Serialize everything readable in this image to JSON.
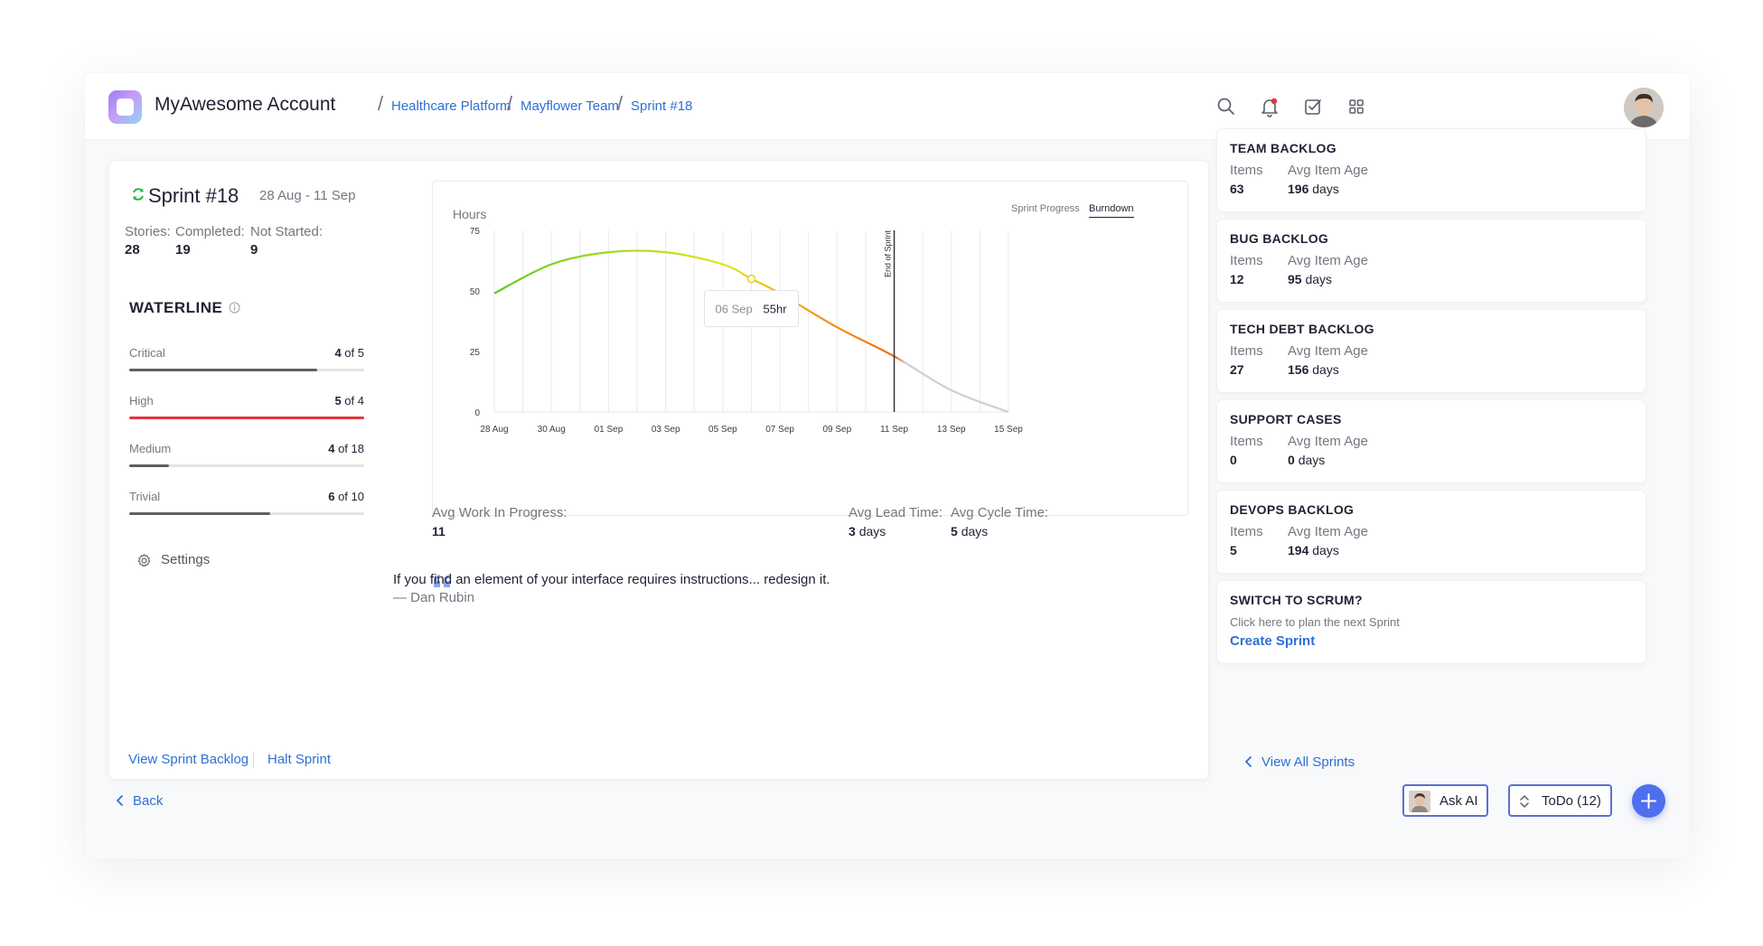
{
  "header": {
    "account": "MyAwesome Account",
    "separator": "/",
    "breadcrumbs": [
      "Healthcare Platform",
      "Mayflower Team",
      "Sprint #18"
    ],
    "icons": [
      "search-icon",
      "bell-icon",
      "checkbox-icon",
      "grid-icon"
    ]
  },
  "sprint": {
    "title": "Sprint #18",
    "dates": "28 Aug - 11 Sep",
    "stats": [
      {
        "label": "Stories:",
        "value": "28"
      },
      {
        "label": "Completed:",
        "value": "19"
      },
      {
        "label": "Not Started:",
        "value": "9"
      }
    ]
  },
  "waterline": {
    "title": "WATERLINE",
    "rows": [
      {
        "label": "Critical",
        "count": "4",
        "of": "of",
        "total": "5",
        "fill": 0.8,
        "color": "#5d5f66"
      },
      {
        "label": "High",
        "count": "5",
        "of": "of",
        "total": "4",
        "fill": 1.0,
        "color": "#e5343d"
      },
      {
        "label": "Medium",
        "count": "4",
        "of": "of",
        "total": "18",
        "fill": 0.17,
        "color": "#5d5f66"
      },
      {
        "label": "Trivial",
        "count": "6",
        "of": "of",
        "total": "10",
        "fill": 0.6,
        "color": "#5d5f66"
      }
    ],
    "settings": "Settings"
  },
  "chart_data": {
    "type": "line",
    "ylabel": "Hours",
    "tabs": [
      "Sprint Progress",
      "Burndown"
    ],
    "active_tab": "Burndown",
    "x_ticks": [
      "28 Aug",
      "30 Aug",
      "01 Sep",
      "03 Sep",
      "05 Sep",
      "07 Sep",
      "09 Sep",
      "11 Sep",
      "13 Sep",
      "15 Sep"
    ],
    "y_ticks": [
      0,
      25,
      50,
      75
    ],
    "ylim": [
      0,
      75
    ],
    "x": [
      "28 Aug",
      "30 Aug",
      "01 Sep",
      "03 Sep",
      "05 Sep",
      "06 Sep",
      "07 Sep",
      "09 Sep",
      "11 Sep",
      "13 Sep",
      "15 Sep"
    ],
    "values": [
      49,
      61,
      66,
      66,
      61,
      55,
      49,
      35,
      23,
      9,
      0
    ],
    "marker": {
      "label": "End of Sprint",
      "x": "11 Sep"
    },
    "tooltip": {
      "date": "06 Sep",
      "value": "55hr"
    },
    "gradient": [
      "#5dcc1f",
      "#e6e41d",
      "#f39b17",
      "#f26b0e",
      "#cfd0d4"
    ],
    "grid": true
  },
  "metrics": [
    {
      "label": "Avg Work In Progress:",
      "value": "11",
      "unit": ""
    },
    {
      "label": "Avg Lead Time:",
      "value": "3",
      "unit": "days"
    },
    {
      "label": "Avg Cycle Time:",
      "value": "5",
      "unit": "days"
    }
  ],
  "quote": {
    "text": "If you find an element of your interface requires instructions... redesign it.",
    "author": "— Dan Rubin"
  },
  "footer_links": {
    "view_backlog": "View Sprint Backlog",
    "halt": "Halt Sprint",
    "back": "Back",
    "view_all": "View All Sprints"
  },
  "backlogs": [
    {
      "title": "TEAM BACKLOG",
      "items_label": "Items",
      "items": "63",
      "age_label": "Avg Item Age",
      "age": "196",
      "unit": "days"
    },
    {
      "title": "BUG BACKLOG",
      "items_label": "Items",
      "items": "12",
      "age_label": "Avg Item Age",
      "age": "95",
      "unit": "days"
    },
    {
      "title": "TECH DEBT BACKLOG",
      "items_label": "Items",
      "items": "27",
      "age_label": "Avg Item Age",
      "age": "156",
      "unit": "days"
    },
    {
      "title": "SUPPORT CASES",
      "items_label": "Items",
      "items": "0",
      "age_label": "Avg Item Age",
      "age": "0",
      "unit": "days"
    },
    {
      "title": "DEVOPS BACKLOG",
      "items_label": "Items",
      "items": "5",
      "age_label": "Avg Item Age",
      "age": "194",
      "unit": "days"
    }
  ],
  "scrum": {
    "title": "SWITCH TO SCRUM?",
    "subtitle": "Click here to plan the next Sprint",
    "link": "Create Sprint"
  },
  "actions": {
    "ask_ai": "Ask AI",
    "todo": "ToDo (12)",
    "fab": "plus-icon"
  },
  "colors": {
    "accent": "#2f6fd6",
    "danger": "#e5343d",
    "button_border": "#5a6fd6",
    "fab": "#4f6ff0"
  }
}
